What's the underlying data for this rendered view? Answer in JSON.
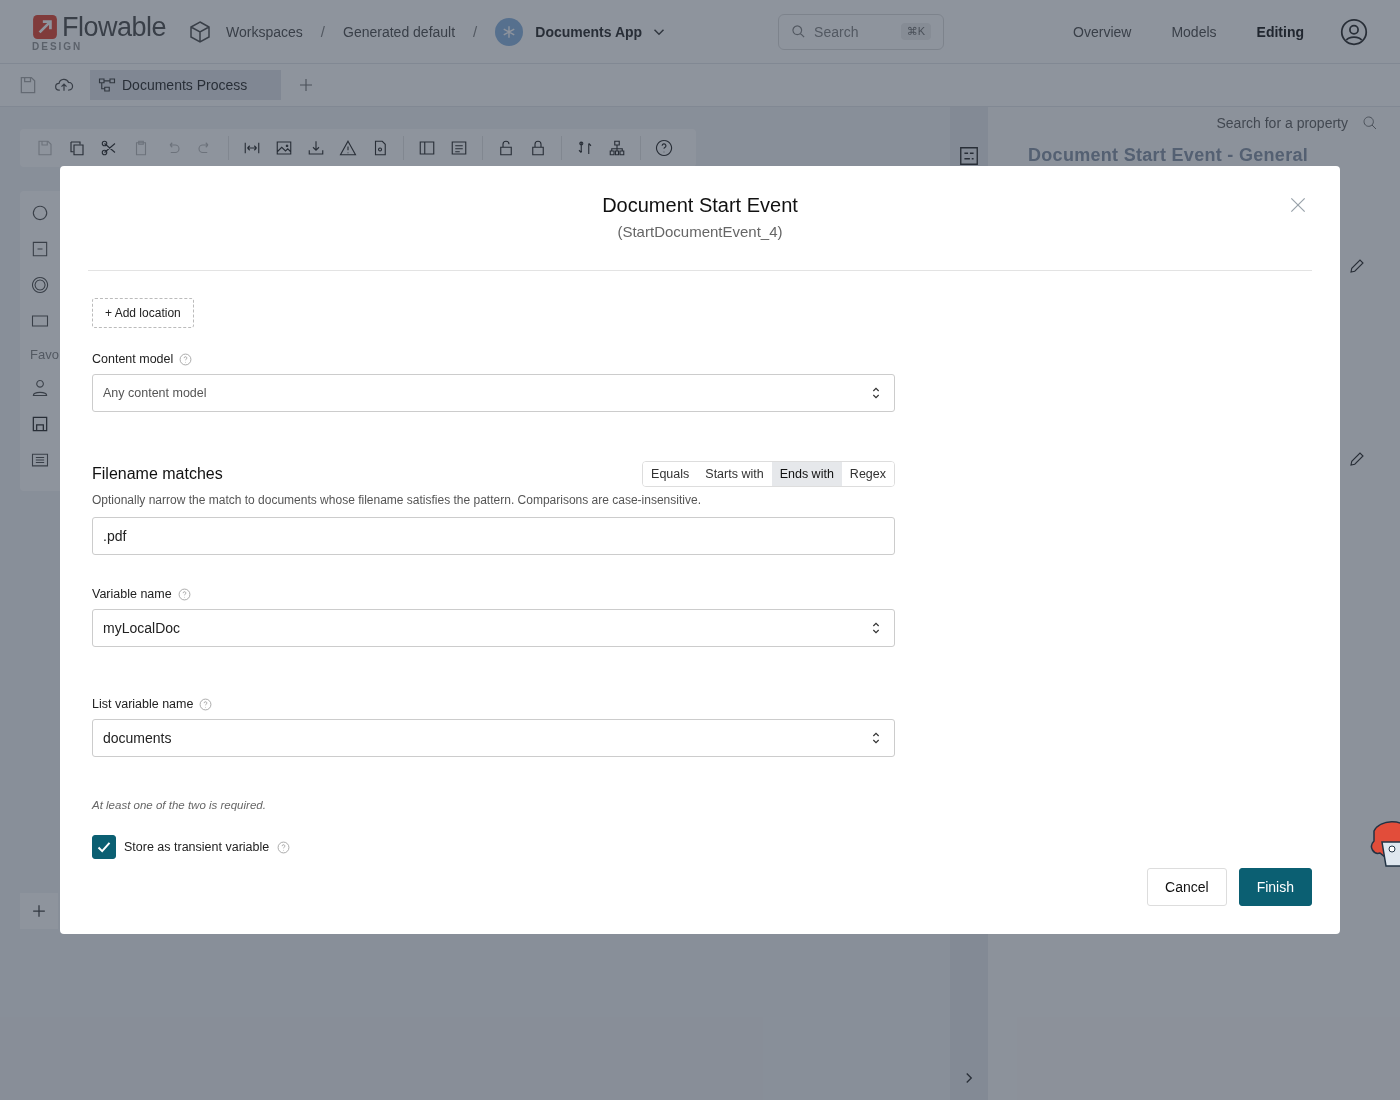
{
  "header": {
    "logo": "Flowable",
    "logo_sub": "DESIGN",
    "breadcrumbs": [
      {
        "label": "Workspaces"
      },
      {
        "separator": "/",
        "label": "Generated default"
      },
      {
        "separator": "/",
        "label": "Documents App"
      }
    ],
    "search": {
      "placeholder": "Search",
      "shortcut": "⌘K"
    },
    "nav": [
      {
        "label": "Overview",
        "selected": false
      },
      {
        "label": "Models",
        "selected": false
      },
      {
        "label": "Editing",
        "selected": true
      }
    ]
  },
  "tabs": [
    {
      "label": "Documents Process",
      "selected": true
    }
  ],
  "palette": {
    "section": "Favo"
  },
  "properties": {
    "search": {
      "placeholder": "Search for a property"
    },
    "title": "Document Start Event - General"
  },
  "dialog": {
    "title": "Document Start Event",
    "subtitle": "(StartDocumentEvent_4)",
    "add_location": "+ Add location",
    "content_model": {
      "label": "Content model",
      "placeholder": "Any content model"
    },
    "filename": {
      "heading": "Filename matches",
      "modes": [
        {
          "label": "Equals",
          "selected": false
        },
        {
          "label": "Starts with",
          "selected": false
        },
        {
          "label": "Ends with",
          "selected": true
        },
        {
          "label": "Regex",
          "selected": false
        }
      ],
      "description": "Optionally narrow the match to documents whose filename satisfies the pattern. Comparisons are case-insensitive.",
      "value": ".pdf"
    },
    "variable_name": {
      "label": "Variable name",
      "value": "myLocalDoc"
    },
    "list_variable_name": {
      "label": "List variable name",
      "value": "documents"
    },
    "hint": "At least one of the two is required.",
    "transient": {
      "label": "Store as transient variable",
      "checked": true
    },
    "buttons": [
      {
        "label": "Cancel",
        "kind": "secondary"
      },
      {
        "label": "Finish",
        "kind": "primary"
      }
    ]
  }
}
